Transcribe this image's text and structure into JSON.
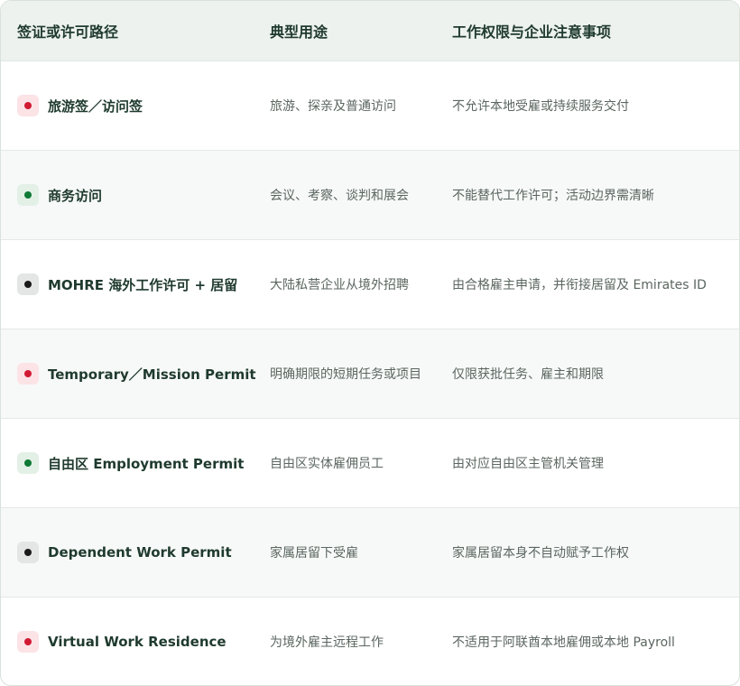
{
  "headers": {
    "route": "签证或许可路径",
    "use": "典型用途",
    "note": "工作权限与企业注意事项"
  },
  "colors": {
    "red": "#d11a33",
    "green": "#0f7a35",
    "black": "#1a1a1a",
    "header_bg": "#edf2ee"
  },
  "rows": [
    {
      "marker": "red",
      "name": "旅游签／访问签",
      "use": "旅游、探亲及普通访问",
      "note": "不允许本地受雇或持续服务交付"
    },
    {
      "marker": "green",
      "name": "商务访问",
      "use": "会议、考察、谈判和展会",
      "note": "不能替代工作许可；活动边界需清晰"
    },
    {
      "marker": "black",
      "name": "MOHRE 海外工作许可 + 居留",
      "use": "大陆私营企业从境外招聘",
      "note": "由合格雇主申请，并衔接居留及 Emirates ID"
    },
    {
      "marker": "red",
      "name": "Temporary／Mission Permit",
      "use": "明确期限的短期任务或项目",
      "note": "仅限获批任务、雇主和期限"
    },
    {
      "marker": "green",
      "name": "自由区 Employment Permit",
      "use": "自由区实体雇佣员工",
      "note": "由对应自由区主管机关管理"
    },
    {
      "marker": "black",
      "name": "Dependent Work Permit",
      "use": "家属居留下受雇",
      "note": "家属居留本身不自动赋予工作权"
    },
    {
      "marker": "red",
      "name": "Virtual Work Residence",
      "use": "为境外雇主远程工作",
      "note": "不适用于阿联酋本地雇佣或本地 Payroll"
    }
  ]
}
